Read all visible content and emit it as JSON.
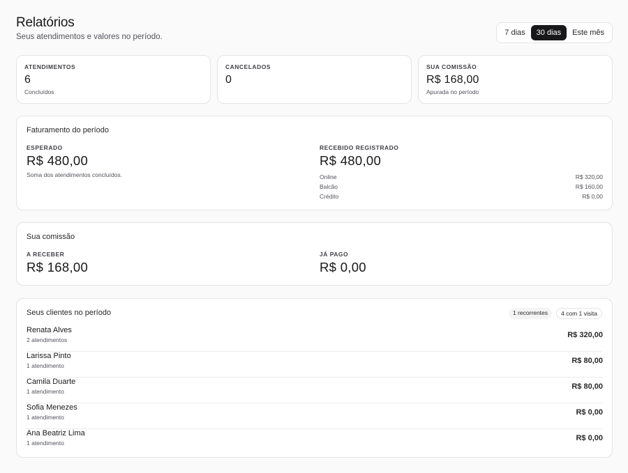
{
  "header": {
    "title": "Relatórios",
    "subtitle": "Seus atendimentos e valores no período."
  },
  "period_filter": {
    "options": [
      "7 dias",
      "30 dias",
      "Este mês"
    ],
    "selected": "30 dias"
  },
  "stats": [
    {
      "label": "ATENDIMENTOS",
      "value": "6",
      "sub": "Concluídos"
    },
    {
      "label": "CANCELADOS",
      "value": "0",
      "sub": ""
    },
    {
      "label": "SUA COMISSÃO",
      "value": "R$ 168,00",
      "sub": "Apurada no período"
    }
  ],
  "faturamento": {
    "title": "Faturamento do período",
    "expected_label": "ESPERADO",
    "expected_value": "R$ 480,00",
    "expected_note": "Soma dos atendimentos concluídos.",
    "received_label": "RECEBIDO REGISTRADO",
    "received_value": "R$ 480,00",
    "methods": [
      {
        "name": "Online",
        "value": "R$ 320,00"
      },
      {
        "name": "Balcão",
        "value": "R$ 160,00"
      },
      {
        "name": "Crédito",
        "value": "R$ 0,00"
      }
    ]
  },
  "comissao": {
    "title": "Sua comissão",
    "receivable_label": "A RECEBER",
    "receivable_value": "R$ 168,00",
    "paid_label": "JÁ PAGO",
    "paid_value": "R$ 0,00"
  },
  "clientes": {
    "title": "Seus clientes no período",
    "badge_recurring": "1 recorrentes",
    "badge_single": "4 com 1 visita",
    "rows": [
      {
        "name": "Renata Alves",
        "count": "2 atendimentos",
        "value": "R$ 320,00"
      },
      {
        "name": "Larissa Pinto",
        "count": "1 atendimento",
        "value": "R$ 80,00"
      },
      {
        "name": "Camila Duarte",
        "count": "1 atendimento",
        "value": "R$ 80,00"
      },
      {
        "name": "Sofia Menezes",
        "count": "1 atendimento",
        "value": "R$ 0,00"
      },
      {
        "name": "Ana Beatriz Lima",
        "count": "1 atendimento",
        "value": "R$ 0,00"
      }
    ]
  }
}
